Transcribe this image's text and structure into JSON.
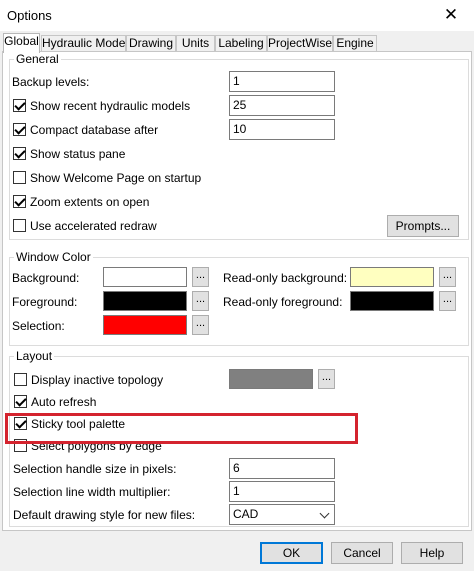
{
  "window": {
    "title": "Options",
    "close_glyph": "✕"
  },
  "tabs": [
    "Global",
    "Hydraulic Model",
    "Drawing",
    "Units",
    "Labeling",
    "ProjectWise",
    "Engine"
  ],
  "general": {
    "title": "General",
    "backup_levels_label": "Backup levels:",
    "backup_levels_value": "1",
    "show_recent_label": "Show recent hydraulic models",
    "show_recent_checked": true,
    "show_recent_value": "25",
    "compact_label": "Compact database after",
    "compact_checked": true,
    "compact_value": "10",
    "status_pane_label": "Show status pane",
    "status_pane_checked": true,
    "welcome_label": "Show Welcome Page on startup",
    "welcome_checked": false,
    "zoom_label": "Zoom extents on open",
    "zoom_checked": true,
    "accel_label": "Use accelerated redraw",
    "accel_checked": false,
    "prompts_label": "Prompts..."
  },
  "window_color": {
    "title": "Window Color",
    "background_label": "Background:",
    "foreground_label": "Foreground:",
    "selection_label": "Selection:",
    "ro_background_label": "Read-only background:",
    "ro_foreground_label": "Read-only foreground:",
    "browse_label": "...",
    "colors": {
      "background": "#ffffff",
      "foreground": "#000000",
      "selection": "#ff0000",
      "ro_background": "#ffffc0",
      "ro_foreground": "#000000",
      "inactive_topology": "#808080",
      "highlight_box": "#d4232e"
    }
  },
  "layout": {
    "title": "Layout",
    "inactive_label": "Display inactive topology",
    "inactive_checked": false,
    "auto_refresh_label": "Auto refresh",
    "auto_refresh_checked": true,
    "sticky_label": "Sticky tool palette",
    "sticky_checked": true,
    "polygons_label": "Select polygons by edge",
    "polygons_checked": false,
    "handle_size_label": "Selection handle size in pixels:",
    "handle_size_value": "6",
    "line_width_label": "Selection line width multiplier:",
    "line_width_value": "1",
    "drawing_style_label": "Default drawing style for new files:",
    "drawing_style_value": "CAD"
  },
  "footer": {
    "ok_label": "OK",
    "cancel_label": "Cancel",
    "help_label": "Help"
  }
}
